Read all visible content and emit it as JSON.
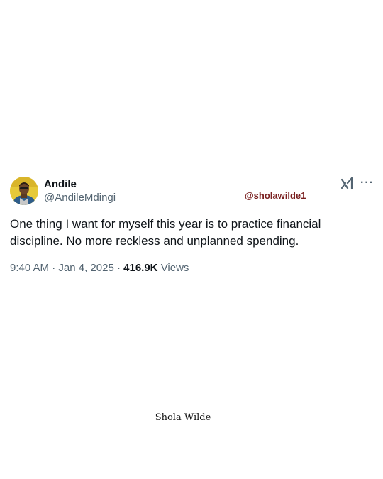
{
  "author": {
    "display_name": "Andile",
    "handle": "@AndileMdingi",
    "avatar_icon": "avatar-photo"
  },
  "watermark": {
    "handle": "@sholawilde1",
    "signature": "Shola Wilde",
    "handle_color": "#7a1f1f"
  },
  "header_icons": {
    "logo": "grok-logo-icon",
    "more": "more-icon",
    "more_glyph": "···"
  },
  "tweet": {
    "text": "One thing I want for myself this year is to practice financial discipline. No more reckless and unplanned spending.",
    "time": "9:40 AM",
    "date": "Jan 4, 2025",
    "separator": "·",
    "views_count": "416.9K",
    "views_label": "Views"
  },
  "colors": {
    "text_primary": "#0f1419",
    "text_secondary": "#536471",
    "background": "#ffffff"
  }
}
